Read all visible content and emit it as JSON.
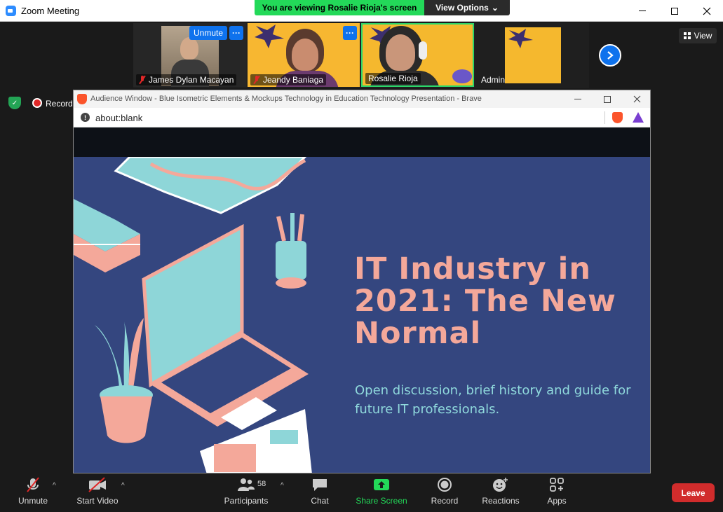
{
  "window": {
    "title": "Zoom Meeting"
  },
  "banner": {
    "viewing": "You are viewing Rosalie Rioja's screen",
    "options": "View Options",
    "options_caret": "⌄"
  },
  "participants": [
    {
      "name": "James Dylan Macayan"
    },
    {
      "name": "Jeandy Baniaga"
    },
    {
      "name": "Rosalie Rioja"
    },
    {
      "name": "Admin"
    }
  ],
  "tile_buttons": {
    "unmute": "Unmute",
    "more": "···"
  },
  "view_button": "View",
  "status": {
    "recording": "Recording"
  },
  "browser": {
    "title": "Audience Window - Blue Isometric Elements & Mockups Technology in Education Technology Presentation - Brave",
    "url": "about:blank",
    "info": "!"
  },
  "slide": {
    "title": "IT Industry in 2021: The New Normal",
    "subtitle": "Open discussion, brief history and guide for future IT professionals."
  },
  "toolbar": {
    "unmute": "Unmute",
    "start_video": "Start Video",
    "participants": "Participants",
    "participant_count": "58",
    "chat": "Chat",
    "share_screen": "Share Screen",
    "record": "Record",
    "reactions": "Reactions",
    "apps": "Apps",
    "leave": "Leave",
    "caret": "^"
  },
  "colors": {
    "share_green": "#23d959",
    "zoom_blue": "#0e72ed",
    "leave_red": "#d12c2c",
    "slide_bg": "#34467f",
    "slide_title": "#f4a89a",
    "slide_sub": "#8fd9dc"
  }
}
